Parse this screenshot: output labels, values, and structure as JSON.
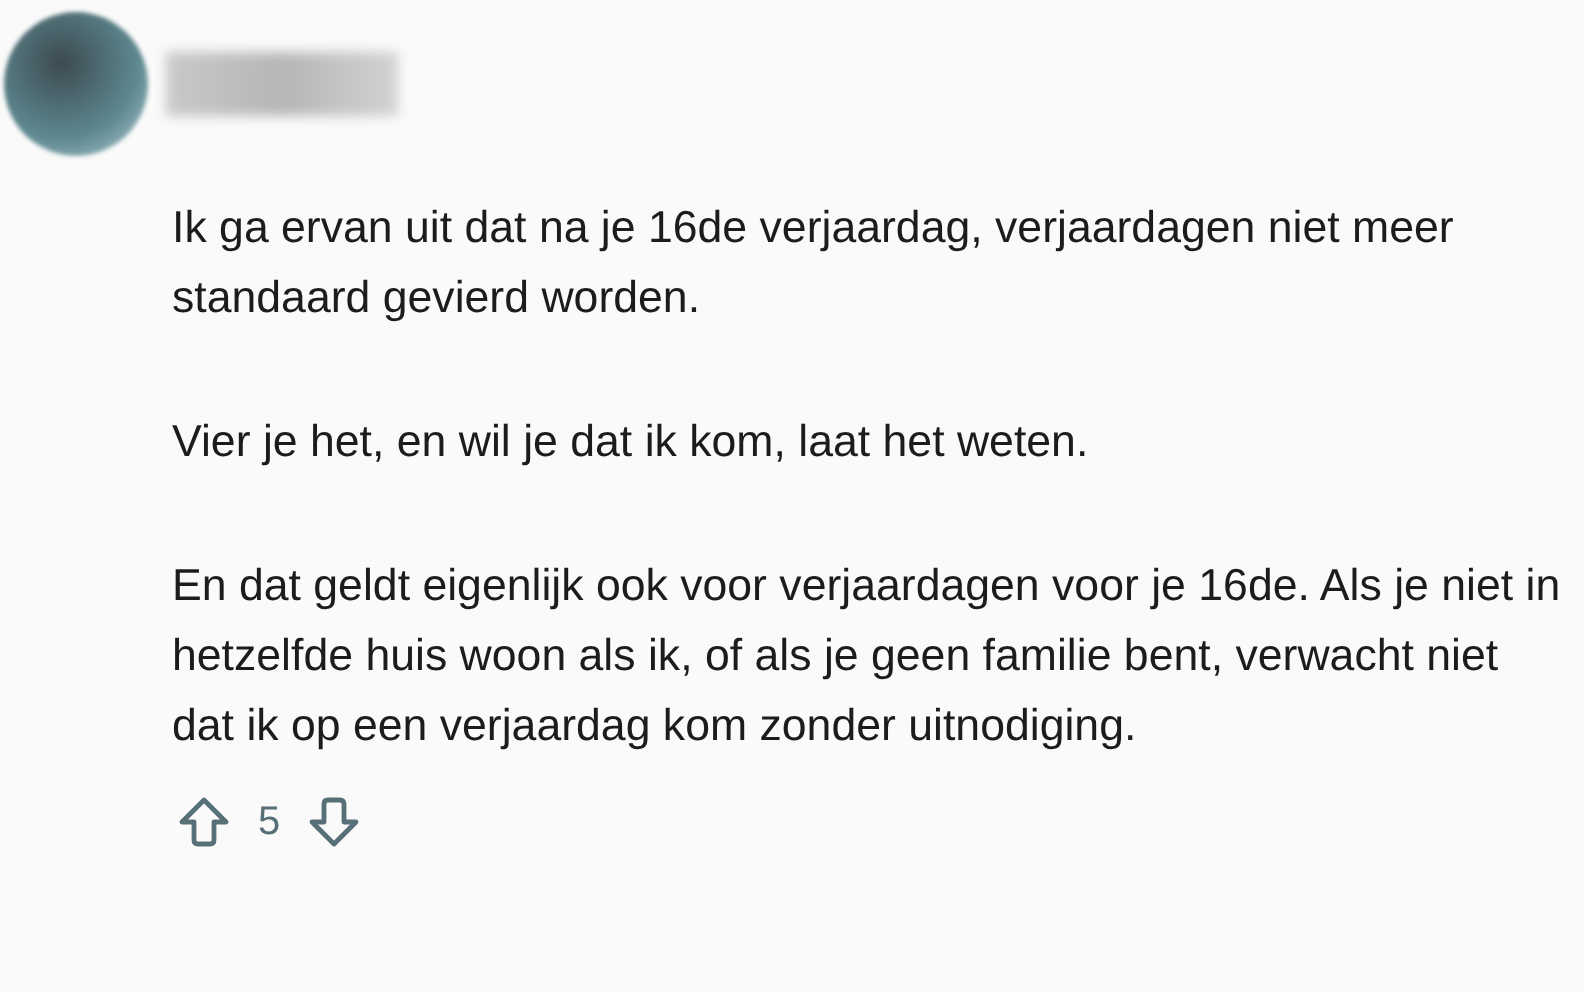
{
  "comment": {
    "paragraphs": [
      "Ik ga ervan uit dat na je 16de verjaardag, verjaardagen niet meer standaard gevierd worden.",
      "Vier je het, en wil je dat ik kom, laat het weten.",
      "En dat geldt eigenlijk ook voor verjaardagen voor je 16de. Als je niet in hetzelfde huis woon als ik, of als je geen familie bent, verwacht niet dat ik op een verjaardag kom zonder uitnodiging."
    ],
    "score": "5"
  }
}
